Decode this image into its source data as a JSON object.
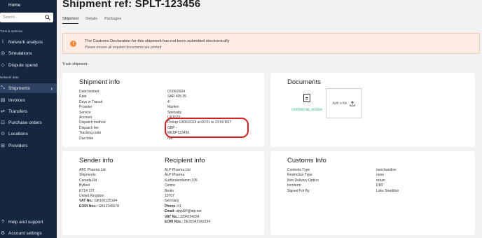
{
  "sidebar": {
    "home_label": "Home",
    "search_placeholder": "Search...",
    "section_optimise": "Tune & optimise",
    "section_network": "Network data",
    "items": [
      {
        "label": "Network analysis"
      },
      {
        "label": "Simulations"
      },
      {
        "label": "Dispute spend"
      },
      {
        "label": "Shipments"
      },
      {
        "label": "Invoices"
      },
      {
        "label": "Transfers"
      },
      {
        "label": "Purchase orders"
      },
      {
        "label": "Locations"
      },
      {
        "label": "Providers"
      }
    ],
    "bottom": [
      {
        "label": "Help and support"
      },
      {
        "label": "Account settings"
      }
    ]
  },
  "header": {
    "title": "Shipment ref: SPLT-123456",
    "tabs": [
      "Shipment",
      "Details",
      "Packages"
    ]
  },
  "alert": {
    "title": "The Customs Declaration for this shipment has not been submitted electronically",
    "subtitle": "Please ensure all required documents are printed"
  },
  "track_label": "Track shipment",
  "shipment_info": {
    "heading": "Shipment info",
    "labels": [
      "Date booked",
      "Rate",
      "Days in Transit",
      "Provider",
      "Service",
      "Account",
      "Dispatch method",
      "Dispatch fee",
      "Tracking code",
      "Due date"
    ],
    "values": [
      "07/06/2024",
      "SAR 495.35",
      "4",
      "Marken",
      "Specialty",
      "UK1072",
      "Pickup 10/06/2024 at 00:01 to 23:59 BST",
      "GBP -",
      "MKDP123456",
      "n/a"
    ]
  },
  "documents": {
    "heading": "Documents",
    "file_name": "commercial_invoice",
    "add_file_label": "Add a file"
  },
  "sender_info": {
    "heading": "Sender info",
    "lines": [
      "ABC Pharma Ltd",
      "Shipments",
      "Canada Rd",
      "Byfleet",
      "KT14 7JT",
      "United Kingdom"
    ],
    "vat_label": "VAT No.:",
    "vat_value": "GB100125104",
    "eori_label": "EORI Nos.:",
    "eori_value": "GB12345678"
  },
  "recipient_info": {
    "heading": "Recipient info",
    "lines": [
      "ALP Pharma Ltd",
      "ALP Pharma",
      "Kurfürstendamm 195",
      "Centre",
      "Berlin",
      "10707",
      "Germany"
    ],
    "phone_label": "Phone:",
    "phone_value": "01",
    "email_label": "Email:",
    "email_value": "alppAP@alp.net",
    "vat_label": "VAT No.:",
    "vat_value": "3234234234",
    "eori_label": "EORI Nos.:",
    "eori_value": "DE32342342234"
  },
  "customs_info": {
    "heading": "Customs Info",
    "labels": [
      "Contents Type",
      "Restriction Type",
      "Non Delivery Option",
      "Incoterm",
      "Signed For By"
    ],
    "values": [
      "merchandise",
      "none",
      "return",
      "DDP",
      "Luke Sneddon"
    ]
  },
  "colors": {
    "sidebar_bg": "#15263f",
    "sidebar_active": "#2e4363",
    "alert_bg": "#fdece4",
    "alert_icon": "#f08a3c",
    "link_green": "#2bb38e",
    "annotation_red": "#d32020"
  },
  "icons": {
    "home": "home-icon",
    "search": "search-icon",
    "warning": "warning-icon",
    "file": "file-icon",
    "upload": "upload-icon"
  }
}
